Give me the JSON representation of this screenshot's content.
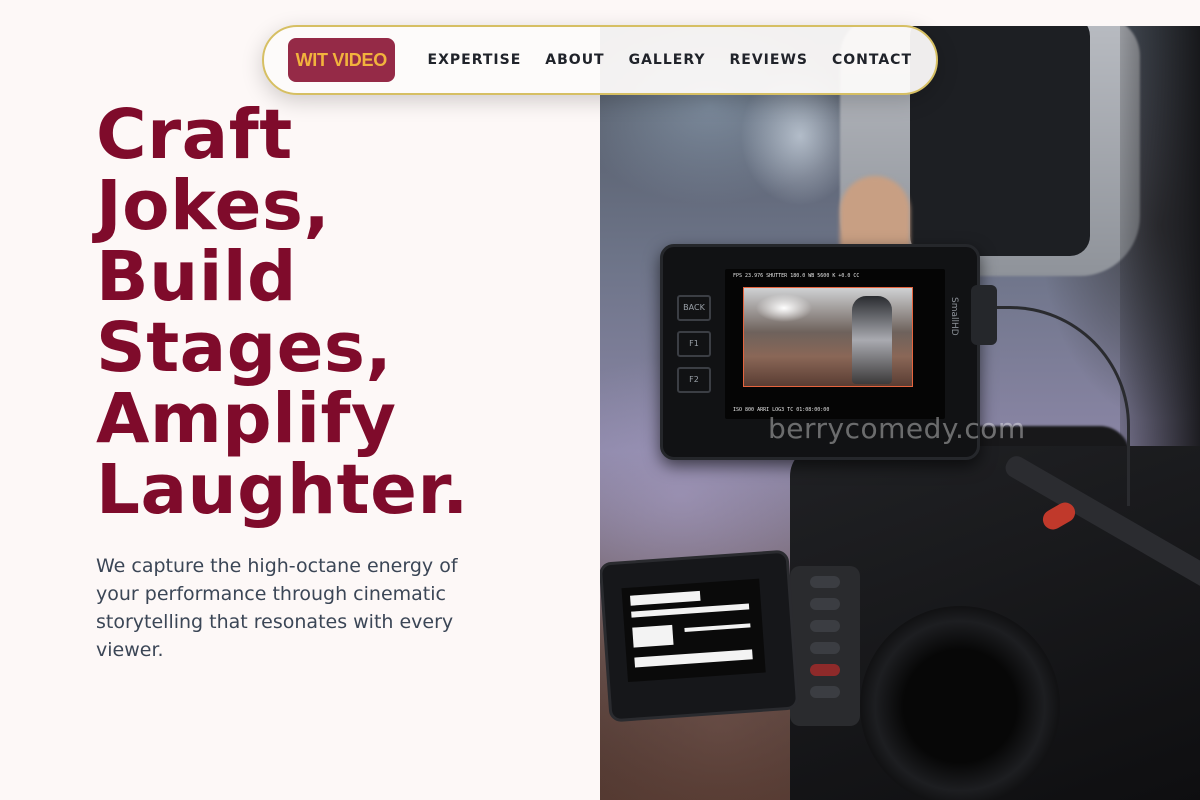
{
  "nav": {
    "logo": "WIT VIDEO",
    "links": [
      "EXPERTISE",
      "ABOUT",
      "GALLERY",
      "REVIEWS",
      "CONTACT"
    ]
  },
  "hero": {
    "headline_lines": [
      "Craft",
      "Jokes,",
      "Build",
      "Stages,",
      "Amplify",
      "Laughter."
    ],
    "subcopy": "We capture the high-octane energy of your performance through cinematic storytelling that resonates with every viewer."
  },
  "image": {
    "watermark": "berrycomedy.com",
    "monitor_brand": "SmallHD",
    "monitor_buttons": [
      "BACK",
      "F1",
      "F2"
    ],
    "hud_top": "FPS 23.976   SHUTTER 180.0   WB 5600 K  +0.0 CC",
    "hud_bottom": "ISO 800   ARRI LOG3   TC 01:08:00:00"
  },
  "colors": {
    "brand_burgundy": "#7f0b2b",
    "logo_bg": "#952a47",
    "logo_text": "#f2b33d",
    "nav_border": "#d6bf63",
    "page_bg": "#fdf8f7",
    "body_text": "#3b4656"
  }
}
